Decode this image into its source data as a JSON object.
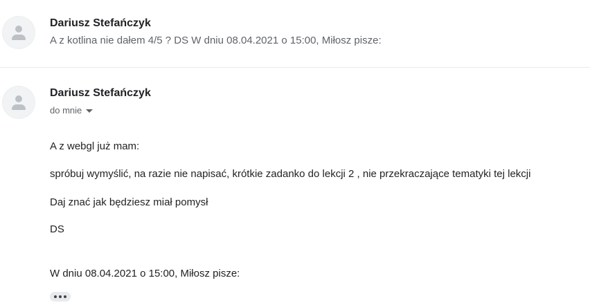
{
  "collapsed_message": {
    "sender": "Dariusz Stefańczyk",
    "snippet": "A z kotlina nie dałem 4/5 ? DS W dniu 08.04.2021 o 15:00, Miłosz pisze:"
  },
  "expanded_message": {
    "sender": "Dariusz Stefańczyk",
    "recipient_label": "do mnie",
    "body_lines": [
      "A z webgl już mam:",
      "spróbuj wymyślić, na razie nie napisać, krótkie zadanko do lekcji 2 , nie przekraczające tematyki tej lekcji",
      "Daj znać jak będziesz miał pomysł",
      "DS"
    ],
    "quote_header": "W dniu 08.04.2021 o 15:00, Miłosz pisze:"
  },
  "icons": {
    "avatar": "person-icon",
    "recipient_details": "chevron-down-icon",
    "show_trimmed": "more-horiz-icon"
  }
}
